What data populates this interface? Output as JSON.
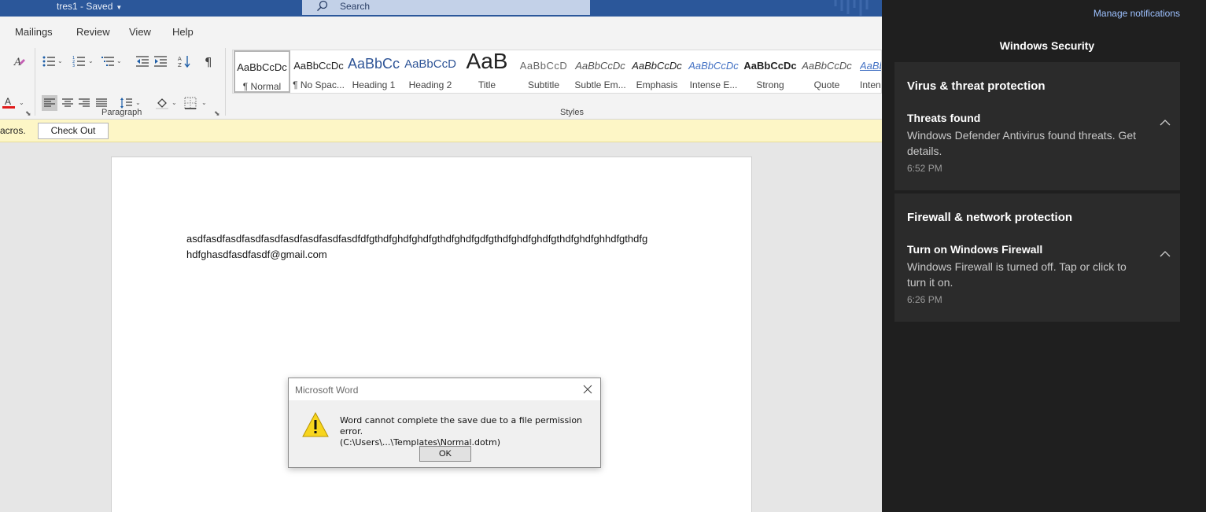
{
  "titlebar": {
    "doc_title": "tres1  -  Saved",
    "search_label": "Search"
  },
  "ribbon": {
    "tabs": [
      "Mailings",
      "Review",
      "View",
      "Help"
    ],
    "groups": {
      "paragraph_label": "Paragraph",
      "styles_label": "Styles"
    },
    "styles": [
      {
        "sample": "AaBbCcDc",
        "name": "¶ Normal"
      },
      {
        "sample": "AaBbCcDc",
        "name": "¶ No Spac..."
      },
      {
        "sample": "AaBbCc",
        "name": "Heading 1"
      },
      {
        "sample": "AaBbCcD",
        "name": "Heading 2"
      },
      {
        "sample": "AaB",
        "name": "Title"
      },
      {
        "sample": "AaBbCcD",
        "name": "Subtitle"
      },
      {
        "sample": "AaBbCcDc",
        "name": "Subtle Em..."
      },
      {
        "sample": "AaBbCcDc",
        "name": "Emphasis"
      },
      {
        "sample": "AaBbCcDc",
        "name": "Intense E..."
      },
      {
        "sample": "AaBbCcDc",
        "name": "Strong"
      },
      {
        "sample": "AaBbCcDc",
        "name": "Quote"
      },
      {
        "sample": "AaBbCcDc",
        "name": "Intens"
      }
    ]
  },
  "message_bar": {
    "text": "acros.",
    "button_label": "Check Out"
  },
  "document": {
    "line1": "asdfasdfasdfasdfasdfasdfasdfasdfasdfdfgthdfghdfghdfgthdfghdfgdfgthdfghdfghdfgthdfghdfghhdfgthdfg",
    "line2": "hdfghasdfasdfasdf@gmail.com"
  },
  "dialog": {
    "title": "Microsoft Word",
    "line1": "Word cannot complete the save due to a file permission error.",
    "line2": " (C:\\Users\\...\\Templates\\Normal.dotm)",
    "ok_label": "OK"
  },
  "notifications": {
    "manage_label": "Manage notifications",
    "app_name": "Windows Security",
    "cards": [
      {
        "category": "Virus & threat protection",
        "title": "Threats found",
        "body": "Windows Defender Antivirus found threats. Get details.",
        "time": "6:52 PM"
      },
      {
        "category": "Firewall & network protection",
        "title": "Turn on Windows Firewall",
        "body": "Windows Firewall is turned off. Tap or click to turn it on.",
        "time": "6:26 PM"
      }
    ]
  },
  "colors": {
    "title_bar": "#2b579a",
    "message_bar": "#fdf6c6",
    "notification_bg": "#1f1f1f",
    "notification_card": "#2b2b2b",
    "link": "#9dc1ff"
  }
}
